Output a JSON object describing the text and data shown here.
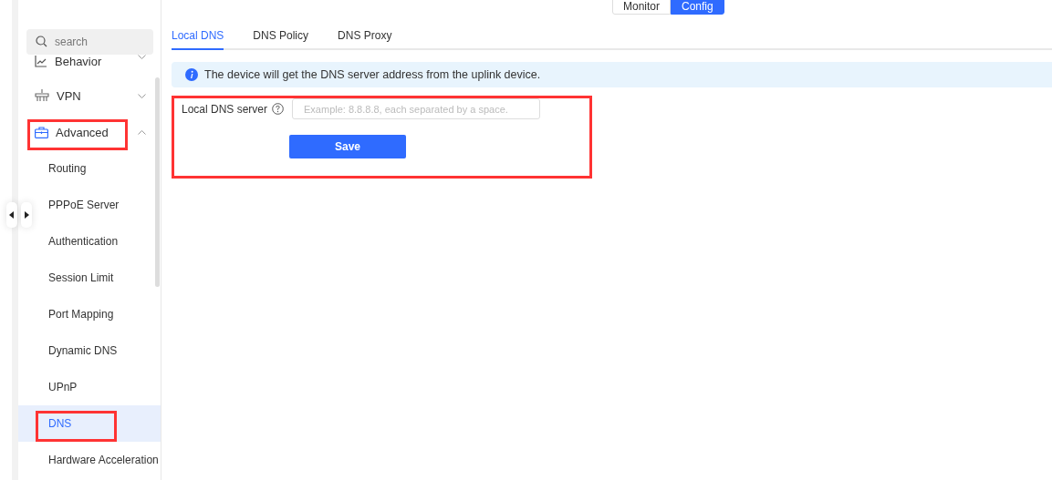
{
  "mode_switch": [
    {
      "label": "Monitor",
      "selected": false
    },
    {
      "label": "Config",
      "selected": true
    }
  ],
  "sidebar": {
    "search": {
      "placeholder": "search"
    },
    "items": [
      {
        "kind": "group",
        "label": "Behavior",
        "expanded": false,
        "selected": false,
        "highlighted": false
      },
      {
        "kind": "group",
        "label": "VPN",
        "expanded": false,
        "selected": false,
        "highlighted": false
      },
      {
        "kind": "group",
        "label": "Advanced",
        "expanded": true,
        "selected": false,
        "highlighted": true
      },
      {
        "kind": "child",
        "label": "Routing",
        "selected": false,
        "highlighted": false
      },
      {
        "kind": "child",
        "label": "PPPoE Server",
        "selected": false,
        "highlighted": false
      },
      {
        "kind": "child",
        "label": "Authentication",
        "selected": false,
        "highlighted": false
      },
      {
        "kind": "child",
        "label": "Session Limit",
        "selected": false,
        "highlighted": false
      },
      {
        "kind": "child",
        "label": "Port Mapping",
        "selected": false,
        "highlighted": false
      },
      {
        "kind": "child",
        "label": "Dynamic DNS",
        "selected": false,
        "highlighted": false
      },
      {
        "kind": "child",
        "label": "UPnP",
        "selected": false,
        "highlighted": false
      },
      {
        "kind": "child",
        "label": "DNS",
        "selected": true,
        "highlighted": true
      },
      {
        "kind": "child",
        "label": "Hardware Acceleration",
        "selected": false,
        "highlighted": false
      }
    ]
  },
  "tabs": [
    {
      "label": "Local DNS",
      "selected": true
    },
    {
      "label": "DNS Policy",
      "selected": false
    },
    {
      "label": "DNS Proxy",
      "selected": false
    }
  ],
  "info": "The device will get the DNS server address from the uplink device.",
  "form": {
    "highlighted": true,
    "label": "Local DNS server",
    "placeholder": "Example: 8.8.8.8, each separated by a space.",
    "button": "Save"
  }
}
